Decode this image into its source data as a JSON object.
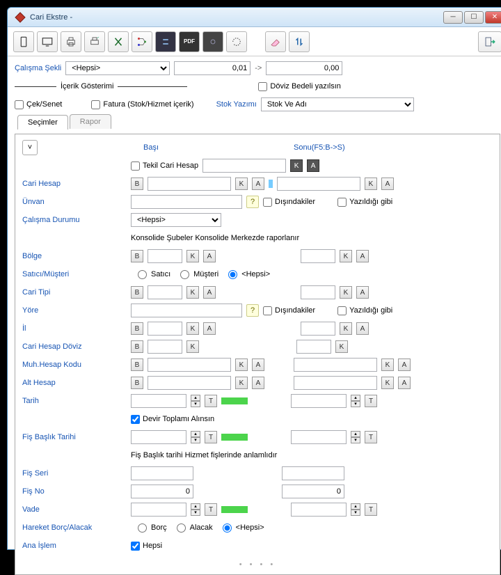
{
  "window": {
    "title": "Cari Ekstre -"
  },
  "toolbar_icons": [
    "portrait",
    "monitor",
    "printer",
    "printer2",
    "excel",
    "tree",
    "swap",
    "pdf",
    "link",
    "refresh",
    "eraser",
    "updown",
    "exit"
  ],
  "topform": {
    "calisma_sekli_label": "Çalışma Şekli",
    "calisma_sekli_value": "<Hepsi>",
    "from_value": "0,01",
    "arrow": "->",
    "to_value": "0,00",
    "icerik_gosterimi_label": "İçerik Gösterimi",
    "doviz_bedeli_label": "Döviz Bedeli yazılsın",
    "cek_senet_label": "Çek/Senet",
    "fatura_label": "Fatura (Stok/Hizmet içerik)",
    "stok_yazimi_label": "Stok Yazımı",
    "stok_yazimi_value": "Stok Ve Adı"
  },
  "tabs": {
    "secimler": "Seçimler",
    "rapor": "Rapor"
  },
  "body": {
    "basi": "Başı",
    "sonu": "Sonu(F5:B->S)",
    "tekil_label": "Tekil Cari Hesap",
    "cari_hesap": "Cari Hesap",
    "unvan": "Ünvan",
    "disindakiler": "Dışındakiler",
    "yazildigi_gibi": "Yazıldığı gibi",
    "calisma_durumu_label": "Çalışma Durumu",
    "calisma_durumu_value": "<Hepsi>",
    "konsolide_note": "Konsolide Şubeler Konsolide Merkezde raporlanır",
    "bolge": "Bölge",
    "satici_musteri": "Satıcı/Müşteri",
    "radio_satici": "Satıcı",
    "radio_musteri": "Müşteri",
    "radio_hepsi": "<Hepsi>",
    "cari_tipi": "Cari Tipi",
    "yore": "Yöre",
    "il": "İl",
    "cari_hesap_doviz": "Cari Hesap Döviz",
    "muh_hesap_kodu": "Muh.Hesap Kodu",
    "alt_hesap": "Alt Hesap",
    "tarih": "Tarih",
    "devir_toplami_label": "Devir Toplamı Alınsın",
    "fis_baslik_tarihi": "Fiş Başlık Tarihi",
    "fis_baslik_note": "Fiş Başlık tarihi Hizmet fişlerinde anlamlıdır",
    "fis_seri": "Fiş Seri",
    "fis_no": "Fiş No",
    "fis_no_from": "0",
    "fis_no_to": "0",
    "vade": "Vade",
    "hareket_ba": "Hareket Borç/Alacak",
    "radio_borc": "Borç",
    "radio_alacak": "Alacak",
    "ana_islem": "Ana İşlem",
    "hepsi": "Hepsi",
    "B": "B",
    "K": "K",
    "A": "A",
    "T": "T"
  }
}
